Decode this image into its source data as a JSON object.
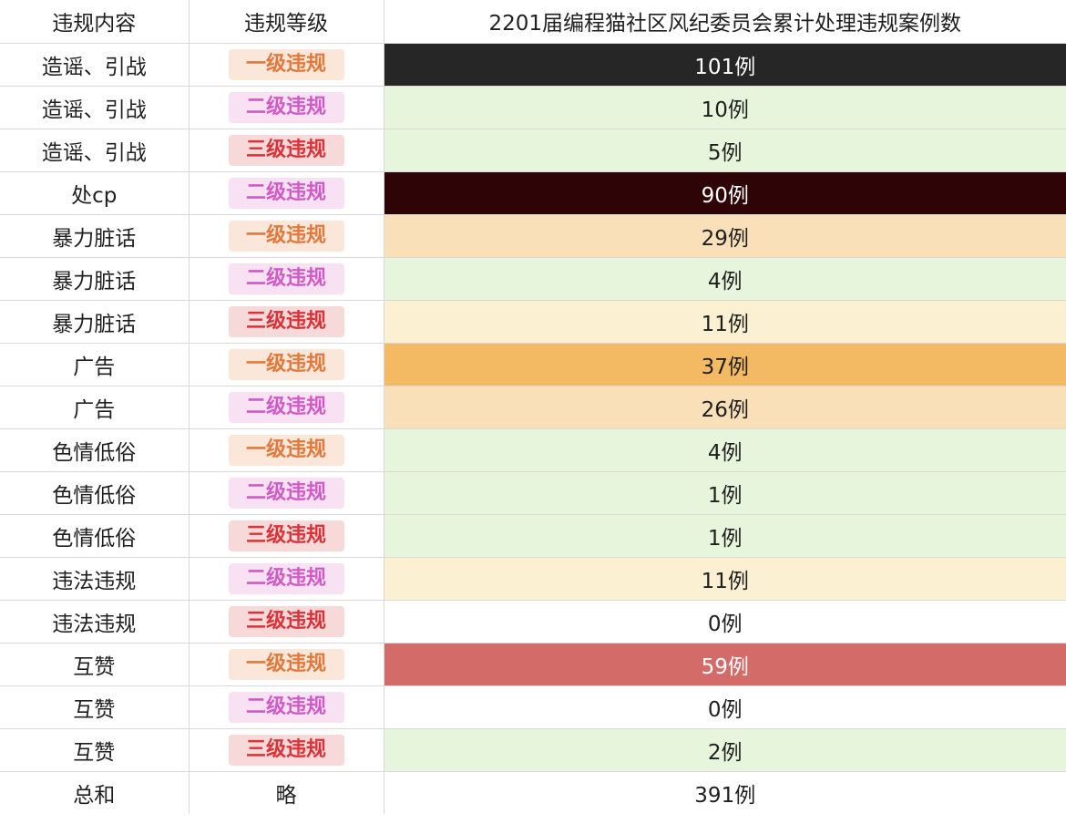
{
  "table": {
    "headers": [
      "违规内容",
      "违规等级",
      "2201届编程猫社区风纪委员会累计处理违规案例数"
    ],
    "level_colors": {
      "一级违规": {
        "bg": "#fbe6da",
        "fg": "#e07a3c"
      },
      "二级违规": {
        "bg": "#f8e1f3",
        "fg": "#d05bc6"
      },
      "三级违规": {
        "bg": "#f7d9d9",
        "fg": "#d9333a"
      }
    },
    "rows": [
      {
        "content": "造谣、引战",
        "level": "一级违规",
        "count": "101例",
        "bg": "#262626",
        "fg": "#ffffff"
      },
      {
        "content": "造谣、引战",
        "level": "二级违规",
        "count": "10例",
        "bg": "#e6f5dc",
        "fg": "#1f1f1f"
      },
      {
        "content": "造谣、引战",
        "level": "三级违规",
        "count": "5例",
        "bg": "#e6f5dc",
        "fg": "#1f1f1f"
      },
      {
        "content": "处cp",
        "level": "二级违规",
        "count": "90例",
        "bg": "#2e0406",
        "fg": "#ffffff"
      },
      {
        "content": "暴力脏话",
        "level": "一级违规",
        "count": "29例",
        "bg": "#f9e0b8",
        "fg": "#1f1f1f"
      },
      {
        "content": "暴力脏话",
        "level": "二级违规",
        "count": "4例",
        "bg": "#e6f5dc",
        "fg": "#1f1f1f"
      },
      {
        "content": "暴力脏话",
        "level": "三级违规",
        "count": "11例",
        "bg": "#fcf0d2",
        "fg": "#1f1f1f"
      },
      {
        "content": "广告",
        "level": "一级违规",
        "count": "37例",
        "bg": "#f4b963",
        "fg": "#1f1f1f"
      },
      {
        "content": "广告",
        "level": "二级违规",
        "count": "26例",
        "bg": "#f9e0b8",
        "fg": "#1f1f1f"
      },
      {
        "content": "色情低俗",
        "level": "一级违规",
        "count": "4例",
        "bg": "#e6f5dc",
        "fg": "#1f1f1f"
      },
      {
        "content": "色情低俗",
        "level": "二级违规",
        "count": "1例",
        "bg": "#e6f5dc",
        "fg": "#1f1f1f"
      },
      {
        "content": "色情低俗",
        "level": "三级违规",
        "count": "1例",
        "bg": "#e6f5dc",
        "fg": "#1f1f1f"
      },
      {
        "content": "违法违规",
        "level": "二级违规",
        "count": "11例",
        "bg": "#fcf0d2",
        "fg": "#1f1f1f"
      },
      {
        "content": "违法违规",
        "level": "三级违规",
        "count": "0例",
        "bg": "#ffffff",
        "fg": "#1f1f1f"
      },
      {
        "content": "互赞",
        "level": "一级违规",
        "count": "59例",
        "bg": "#d36b69",
        "fg": "#ffffff"
      },
      {
        "content": "互赞",
        "level": "二级违规",
        "count": "0例",
        "bg": "#ffffff",
        "fg": "#1f1f1f"
      },
      {
        "content": "互赞",
        "level": "三级违规",
        "count": "2例",
        "bg": "#e6f5dc",
        "fg": "#1f1f1f"
      }
    ],
    "total": {
      "content": "总和",
      "level": "略",
      "count": "391例"
    }
  }
}
